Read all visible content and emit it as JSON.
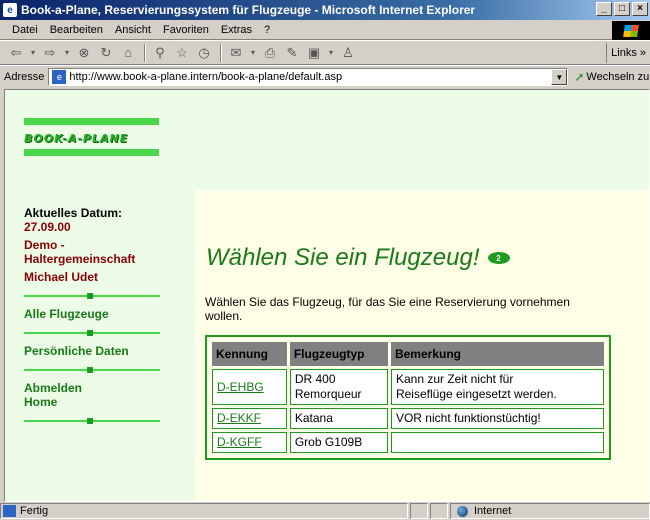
{
  "window": {
    "title": "Book-a-Plane, Reservierungssystem für Flugzeuge - Microsoft Internet Explorer"
  },
  "menu": [
    "Datei",
    "Bearbeiten",
    "Ansicht",
    "Favoriten",
    "Extras",
    "?"
  ],
  "toolbar": {
    "links_label": "Links »"
  },
  "address": {
    "label": "Adresse",
    "url": "http://www.book-a-plane.intern/book-a-plane/default.asp",
    "go_label": "Wechseln zu"
  },
  "logo": {
    "text": "BOOK-A-PLANE"
  },
  "sidebar": {
    "date_label": "Aktuelles Datum:",
    "date_value": "27.09.00",
    "group_line1": "Demo -",
    "group_line2": "Haltergemeinschaft",
    "user": "Michael Udet",
    "nav_all": "Alle Flugzeuge",
    "nav_personal": "Persönliche Daten",
    "nav_logout": "Abmelden",
    "nav_home": "Home"
  },
  "main": {
    "heading": "Wählen Sie ein Flugzeug!",
    "badge": "2",
    "intro": "Wählen Sie das Flugzeug, für das Sie eine Reservierung vornehmen wollen.",
    "table": {
      "headers": [
        "Kennung",
        "Flugzeugtyp",
        "Bemerkung"
      ],
      "rows": [
        {
          "id": "D-EHBG",
          "type_line1": "DR 400",
          "type_line2": "Remorqueur",
          "note_line1": "Kann zur Zeit nicht für",
          "note_line2": "Reiseflüge eingesetzt werden."
        },
        {
          "id": "D-EKKF",
          "type_line1": "Katana",
          "type_line2": "",
          "note_line1": "VOR nicht funktionstüchtig!",
          "note_line2": ""
        },
        {
          "id": "D-KGFF",
          "type_line1": "Grob G109B",
          "type_line2": "",
          "note_line1": "",
          "note_line2": ""
        }
      ]
    }
  },
  "status": {
    "text": "Fertig",
    "zone": "Internet"
  },
  "colors": {
    "accent_green": "#1a7a1a",
    "sidebar_bg": "#ecfce6",
    "content_bg": "#ffffe8",
    "header_gray": "#808080"
  }
}
